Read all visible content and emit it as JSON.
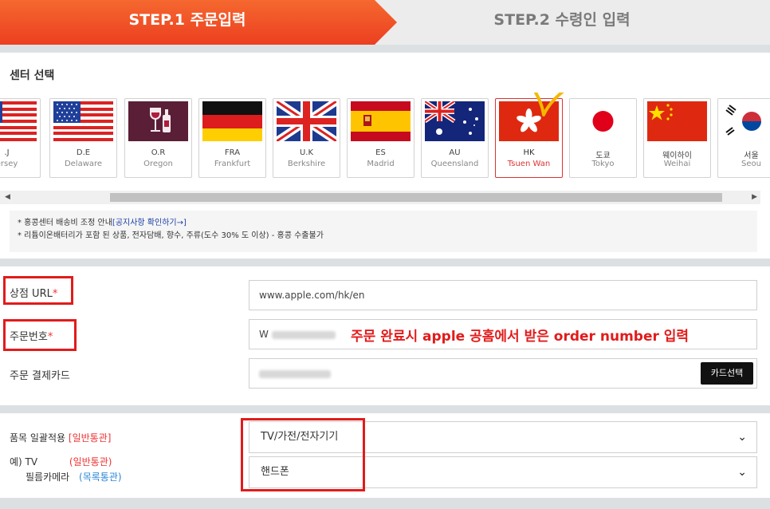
{
  "steps": {
    "step1": "STEP.1 주문입력",
    "step2": "STEP.2 수령인 입력"
  },
  "center_title": "센터 선택",
  "flags": [
    {
      "code": ".J",
      "city": "ersey",
      "flag": "usa-flag"
    },
    {
      "code": "D.E",
      "city": "Delaware",
      "flag": "usa-flag"
    },
    {
      "code": "O.R",
      "city": "Oregon",
      "flag": "wine-icon"
    },
    {
      "code": "FRA",
      "city": "Frankfurt",
      "flag": "germany-flag"
    },
    {
      "code": "U.K",
      "city": "Berkshire",
      "flag": "uk-flag"
    },
    {
      "code": "ES",
      "city": "Madrid",
      "flag": "spain-flag"
    },
    {
      "code": "AU",
      "city": "Queensland",
      "flag": "australia-flag"
    },
    {
      "code": "HK",
      "city": "Tsuen Wan",
      "flag": "hongkong-flag",
      "selected": true
    },
    {
      "code": "도쿄",
      "city": "Tokyo",
      "flag": "japan-flag"
    },
    {
      "code": "웨이하이",
      "city": "Weihai",
      "flag": "china-flag"
    },
    {
      "code": "서울",
      "city": "Seou",
      "flag": "korea-flag"
    }
  ],
  "notice": {
    "line1_prefix": "* 홍콩센터 배송비 조정 안내",
    "line1_link": "[공지사항 확인하기→]",
    "line2": "* 리튬이온배터리가 포함 된 상품, 전자담배, 향수, 주류(도수 30% 도 이상) - 홍콩 수출불가"
  },
  "form": {
    "shop_url_label": "상점 URL",
    "shop_url_value": "www.apple.com/hk/en",
    "order_no_label": "주문번호",
    "order_no_prefix": "W",
    "card_label": "주문 결제카드",
    "card_button": "카드선택",
    "required_mark": "*",
    "annotation": "주문 완료시 apple 공홈에서 받은 order number 입력",
    "category_label": "품목 일괄적용",
    "category_tag": "[일반통관]",
    "example_prefix": "예) TV",
    "example_tv_tag": "(일반통관)",
    "example_camera": "필름카메라",
    "example_camera_tag": "(목록통관)",
    "select1": "TV/가전/전자기기",
    "select2": "핸드폰"
  },
  "colors": {
    "step_active": "#f05a28",
    "accent_red": "#e21b1b",
    "link_blue": "#1a3ea6"
  }
}
